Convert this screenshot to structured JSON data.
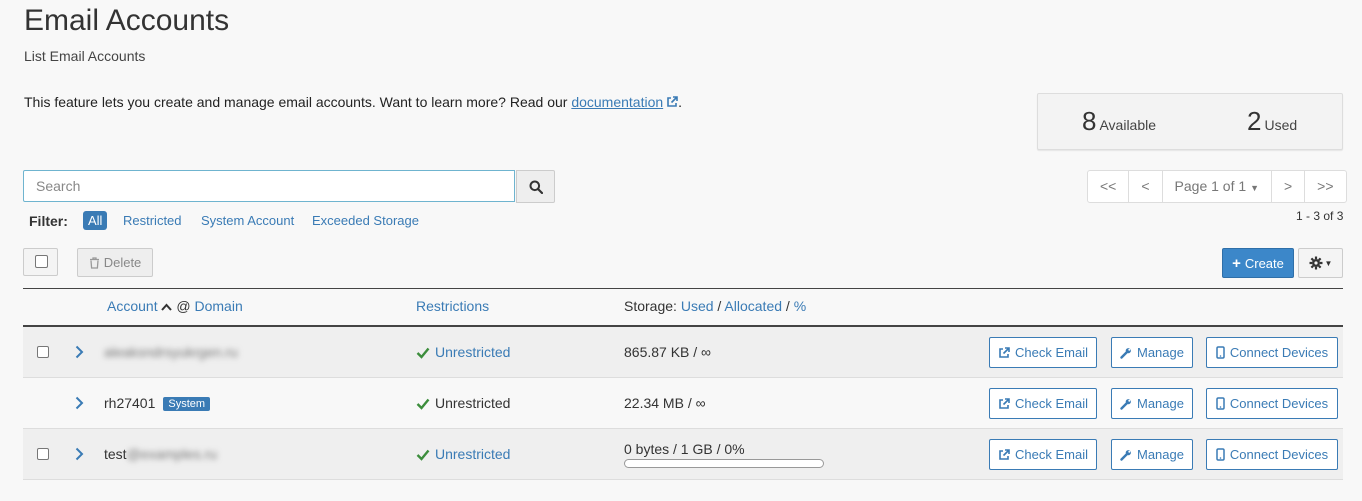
{
  "header": {
    "title": "Email Accounts",
    "subtitle": "List Email Accounts",
    "intro": "This feature lets you create and manage email accounts. Want to learn more? Read our",
    "doc_link": "documentation",
    "intro_end": "."
  },
  "stats": {
    "available_count": "8",
    "available_label": "Available",
    "used_count": "2",
    "used_label": "Used"
  },
  "search": {
    "placeholder": "Search",
    "value": ""
  },
  "filters": {
    "label": "Filter:",
    "items": [
      "All",
      "Restricted",
      "System Account",
      "Exceeded Storage"
    ],
    "active": "All"
  },
  "pagination": {
    "first": "<<",
    "prev": "<",
    "page": "Page 1 of 1",
    "next": ">",
    "last": ">>",
    "range": "1 - 3 of 3"
  },
  "toolbar": {
    "delete_label": "Delete",
    "create_label": "Create"
  },
  "table": {
    "account_header": "Account",
    "at": "@",
    "domain_header": "Domain",
    "restrictions_header": "Restrictions",
    "storage_prefix": "Storage:",
    "storage_used": "Used",
    "storage_sep1": "/",
    "storage_allocated": "Allocated",
    "storage_sep2": "/",
    "storage_pct": "%"
  },
  "rows": [
    {
      "account_prefix": "",
      "account_blurred": "aleaksndrsyukrgen.ru",
      "badge": "",
      "restriction": "Unrestricted",
      "storage": "865.87 KB / ∞",
      "check_email": "Check Email",
      "manage": "Manage",
      "connect": "Connect Devices"
    },
    {
      "account_prefix": "rh27401",
      "account_blurred": "",
      "badge": "System",
      "restriction": "Unrestricted",
      "storage": "22.34 MB / ∞",
      "check_email": "Check Email",
      "manage": "Manage",
      "connect": "Connect Devices"
    },
    {
      "account_prefix": "test",
      "account_blurred": "@examples.ru",
      "badge": "",
      "restriction": "Unrestricted",
      "storage": "0 bytes / 1 GB / 0%",
      "storage_fraction": 0,
      "check_email": "Check Email",
      "manage": "Manage",
      "connect": "Connect Devices"
    }
  ],
  "colors": {
    "accent": "#3a7bb5",
    "success": "#3c8d3c",
    "create": "#3c87c9"
  }
}
